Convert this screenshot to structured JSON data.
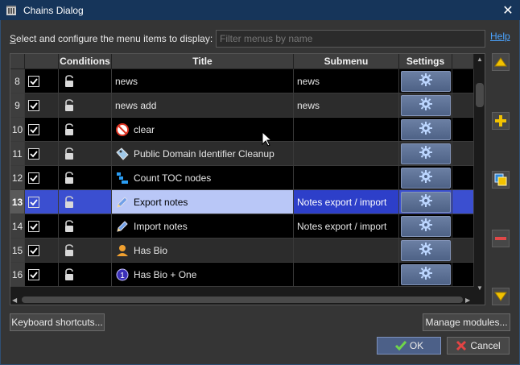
{
  "window": {
    "title": "Chains Dialog",
    "close_label": "✕"
  },
  "filter": {
    "label_prefix": "",
    "label_underlined": "S",
    "label_rest": "elect and configure the menu items to display:",
    "placeholder": "Filter menus by name",
    "value": ""
  },
  "help_label": "Help",
  "table": {
    "columns": [
      "",
      "Conditions",
      "Title",
      "Submenu",
      "Settings"
    ],
    "rows": [
      {
        "num": "8",
        "checked": true,
        "title": "news",
        "submenu": "news",
        "icon": "none",
        "style": "dark"
      },
      {
        "num": "9",
        "checked": true,
        "title": "news add",
        "submenu": "news",
        "icon": "none",
        "style": "light"
      },
      {
        "num": "10",
        "checked": true,
        "title": "clear",
        "submenu": "",
        "icon": "no-entry-icon",
        "style": "dark"
      },
      {
        "num": "11",
        "checked": true,
        "title": "Public Domain Identifier Cleanup",
        "submenu": "",
        "icon": "tag-icon",
        "style": "light"
      },
      {
        "num": "12",
        "checked": true,
        "title": "Count TOC nodes",
        "submenu": "",
        "icon": "toc-count-icon",
        "style": "dark"
      },
      {
        "num": "13",
        "checked": true,
        "title": "Export notes",
        "submenu": "Notes export / import",
        "icon": "pencil-icon",
        "style": "sel"
      },
      {
        "num": "14",
        "checked": true,
        "title": "Import notes",
        "submenu": "Notes export / import",
        "icon": "pencil-icon",
        "style": "dark"
      },
      {
        "num": "15",
        "checked": true,
        "title": "Has Bio",
        "submenu": "",
        "icon": "person-icon",
        "style": "light"
      },
      {
        "num": "16",
        "checked": true,
        "title": "Has Bio + One",
        "submenu": "",
        "icon": "number-one-icon",
        "style": "dark"
      }
    ]
  },
  "buttons": {
    "keyboard_shortcuts": "Keyboard shortcuts...",
    "manage_modules": "Manage modules...",
    "ok": "OK",
    "cancel": "Cancel"
  },
  "colors": {
    "titlebar": "#16355a",
    "selection": "#3b4fd0",
    "link": "#4aa3ff"
  }
}
